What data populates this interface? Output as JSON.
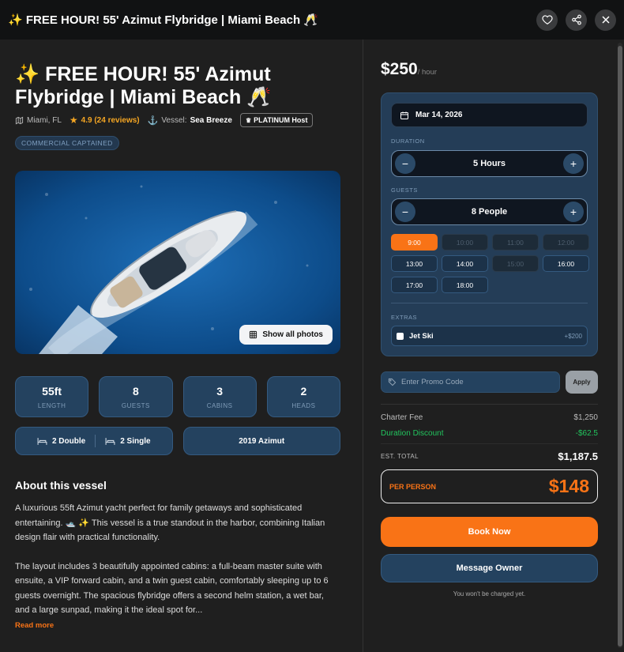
{
  "topbar": {
    "title": "✨ FREE HOUR! 55' Azimut Flybridge | Miami Beach 🥂"
  },
  "listing": {
    "title": "✨ FREE HOUR! 55' Azimut Flybridge | Miami Beach 🥂",
    "location": "Miami, FL",
    "rating": "4.9 (24 reviews)",
    "vessel_label": "Vessel:",
    "vessel_name": "Sea Breeze",
    "host_badge": "PLATINUM Host",
    "category": "COMMERCIAL CAPTAINED",
    "show_photos": "Show all photos",
    "stats": [
      {
        "value": "55ft",
        "label": "LENGTH"
      },
      {
        "value": "8",
        "label": "GUESTS"
      },
      {
        "value": "3",
        "label": "CABINS"
      },
      {
        "value": "2",
        "label": "HEADS"
      }
    ],
    "beds": {
      "double": "2 Double",
      "single": "2 Single"
    },
    "model": "2019 Azimut",
    "about_title": "About this vessel",
    "desc1": "A luxurious 55ft Azimut yacht perfect for family getaways and sophisticated entertaining. 🛥️ ✨ This vessel is a true standout in the harbor, combining Italian design flair with practical functionality.",
    "desc2": "The layout includes 3 beautifully appointed cabins: a full-beam master suite with ensuite, a VIP forward cabin, and a twin guest cabin, comfortably sleeping up to 6 guests overnight. The spacious flybridge offers a second helm station, a wet bar, and a large sunpad, making it the ideal spot for...",
    "read_more": "Read more"
  },
  "booking": {
    "price": "$250",
    "per": "/ hour",
    "date": "Mar 14, 2026",
    "duration_label": "DURATION",
    "duration": "5 Hours",
    "guests_label": "GUESTS",
    "guests": "8 People",
    "slots": [
      {
        "t": "9:00",
        "s": "selected"
      },
      {
        "t": "10:00",
        "s": "disabled"
      },
      {
        "t": "11:00",
        "s": "disabled"
      },
      {
        "t": "12:00",
        "s": "disabled"
      },
      {
        "t": "13:00",
        "s": "available"
      },
      {
        "t": "14:00",
        "s": "available"
      },
      {
        "t": "15:00",
        "s": "disabled"
      },
      {
        "t": "16:00",
        "s": "available"
      },
      {
        "t": "17:00",
        "s": "available"
      },
      {
        "t": "18:00",
        "s": "available"
      }
    ],
    "extras_label": "EXTRAS",
    "extra_name": "Jet Ski",
    "extra_price": "+$200",
    "promo_placeholder": "Enter Promo Code",
    "apply": "Apply",
    "charter_fee_label": "Charter Fee",
    "charter_fee": "$1,250",
    "discount_label": "Duration Discount",
    "discount": "-$62.5",
    "total_label": "EST. TOTAL",
    "total": "$1,187.5",
    "per_person_label": "PER PERSON",
    "per_person": "$148",
    "book_now": "Book Now",
    "message_owner": "Message Owner",
    "note": "You won't be charged yet."
  },
  "colors": {
    "accent": "#f97316",
    "panel": "#243d57",
    "green": "#22c55e"
  }
}
